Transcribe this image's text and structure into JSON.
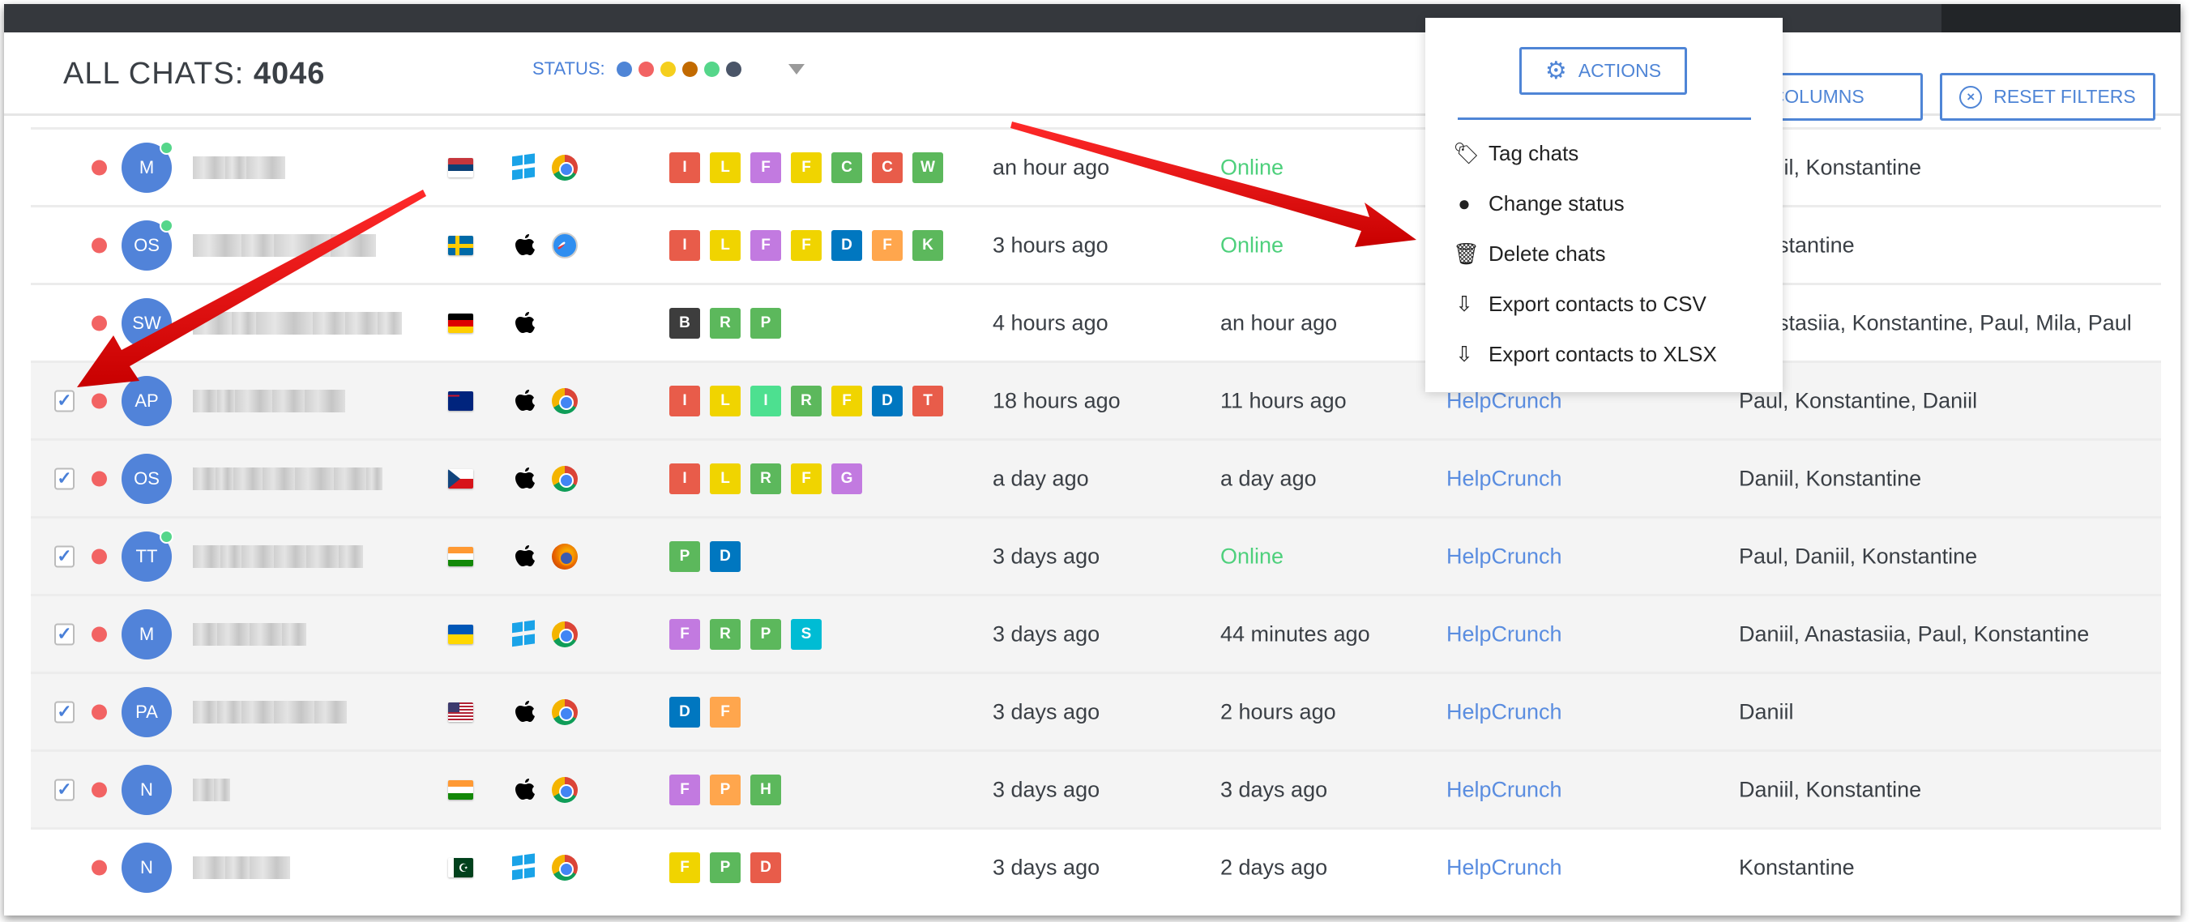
{
  "header": {
    "title_label": "ALL CHATS:",
    "title_count": "4046",
    "status_label": "STATUS:",
    "status_colors": [
      "#4f85d6",
      "#f26363",
      "#f5cf1d",
      "#c26a00",
      "#55d68a",
      "#4a5568"
    ],
    "edit_columns_label": "EDIT COLUMNS",
    "reset_filters_label": "RESET FILTERS"
  },
  "actions_menu": {
    "button_label": "ACTIONS",
    "items": [
      {
        "label": "Tag chats",
        "icon": "tag-icon"
      },
      {
        "label": "Change status",
        "icon": "circle-icon"
      },
      {
        "label": "Delete chats",
        "icon": "trash-icon"
      },
      {
        "label": "Export contacts to CSV",
        "icon": "download-icon"
      },
      {
        "label": "Export contacts to XLSX",
        "icon": "download-icon"
      }
    ]
  },
  "colors": {
    "accent": "#4f85d6",
    "online": "#4ed07c",
    "annotation_arrow": "#e00000"
  },
  "rows": [
    {
      "selected": false,
      "initials": "M",
      "online": true,
      "flag": "serbia",
      "os": "windows",
      "browser": "chrome",
      "tags": [
        [
          "I",
          "#e85c4a"
        ],
        [
          "L",
          "#f0d400"
        ],
        [
          "F",
          "#c27ae0"
        ],
        [
          "F",
          "#f0d400"
        ],
        [
          "C",
          "#5cb85c"
        ],
        [
          "C",
          "#e85c4a"
        ],
        [
          "W",
          "#5cb85c"
        ]
      ],
      "last_message": "an hour ago",
      "last_seen": "Online",
      "department": "",
      "agents": "Daniil, Konstantine"
    },
    {
      "selected": false,
      "initials": "OS",
      "online": true,
      "flag": "sweden",
      "os": "apple",
      "browser": "safari",
      "tags": [
        [
          "I",
          "#e85c4a"
        ],
        [
          "L",
          "#f0d400"
        ],
        [
          "F",
          "#c27ae0"
        ],
        [
          "F",
          "#f0d400"
        ],
        [
          "D",
          "#0077c0"
        ],
        [
          "F",
          "#ffa64d"
        ],
        [
          "K",
          "#5cb85c"
        ]
      ],
      "last_message": "3 hours ago",
      "last_seen": "Online",
      "department": "",
      "agents": "Konstantine"
    },
    {
      "selected": false,
      "initials": "SW",
      "online": false,
      "flag": "germany",
      "os": "apple",
      "browser": "",
      "tags": [
        [
          "B",
          "#3d3d3d"
        ],
        [
          "R",
          "#5cb85c"
        ],
        [
          "P",
          "#5cb85c"
        ]
      ],
      "last_message": "4 hours ago",
      "last_seen": "an hour ago",
      "department": "",
      "agents": "Anastasiia, Konstantine, Paul, Mila, Paul"
    },
    {
      "selected": true,
      "initials": "AP",
      "online": false,
      "flag": "new-zealand",
      "os": "apple",
      "browser": "chrome",
      "tags": [
        [
          "I",
          "#e85c4a"
        ],
        [
          "L",
          "#f0d400"
        ],
        [
          "I",
          "#4de090"
        ],
        [
          "R",
          "#5cb85c"
        ],
        [
          "F",
          "#f0d400"
        ],
        [
          "D",
          "#0077c0"
        ],
        [
          "T",
          "#e85c4a"
        ]
      ],
      "last_message": "18 hours ago",
      "last_seen": "11 hours ago",
      "department": "HelpCrunch",
      "agents": "Paul, Konstantine, Daniil"
    },
    {
      "selected": true,
      "initials": "OS",
      "online": false,
      "flag": "czech",
      "os": "apple",
      "browser": "chrome",
      "tags": [
        [
          "I",
          "#e85c4a"
        ],
        [
          "L",
          "#f0d400"
        ],
        [
          "R",
          "#5cb85c"
        ],
        [
          "F",
          "#f0d400"
        ],
        [
          "G",
          "#c27ae0"
        ]
      ],
      "last_message": "a day ago",
      "last_seen": "a day ago",
      "department": "HelpCrunch",
      "agents": "Daniil, Konstantine"
    },
    {
      "selected": true,
      "initials": "TT",
      "online": true,
      "flag": "india",
      "os": "apple",
      "browser": "firefox",
      "tags": [
        [
          "P",
          "#5cb85c"
        ],
        [
          "D",
          "#0077c0"
        ]
      ],
      "last_message": "3 days ago",
      "last_seen": "Online",
      "department": "HelpCrunch",
      "agents": "Paul, Daniil, Konstantine"
    },
    {
      "selected": true,
      "initials": "M",
      "online": false,
      "flag": "ukraine",
      "os": "windows",
      "browser": "chrome",
      "tags": [
        [
          "F",
          "#c27ae0"
        ],
        [
          "R",
          "#5cb85c"
        ],
        [
          "P",
          "#5cb85c"
        ],
        [
          "S",
          "#00bcd4"
        ]
      ],
      "last_message": "3 days ago",
      "last_seen": "44 minutes ago",
      "department": "HelpCrunch",
      "agents": "Daniil, Anastasiia, Paul, Konstantine"
    },
    {
      "selected": true,
      "initials": "PA",
      "online": false,
      "flag": "usa",
      "os": "apple",
      "browser": "chrome",
      "tags": [
        [
          "D",
          "#0077c0"
        ],
        [
          "F",
          "#ffa64d"
        ]
      ],
      "last_message": "3 days ago",
      "last_seen": "2 hours ago",
      "department": "HelpCrunch",
      "agents": "Daniil"
    },
    {
      "selected": true,
      "initials": "N",
      "online": false,
      "flag": "india",
      "os": "apple",
      "browser": "chrome",
      "tags": [
        [
          "F",
          "#c27ae0"
        ],
        [
          "P",
          "#ffa64d"
        ],
        [
          "H",
          "#5cb85c"
        ]
      ],
      "last_message": "3 days ago",
      "last_seen": "3 days ago",
      "department": "HelpCrunch",
      "agents": "Daniil, Konstantine"
    },
    {
      "selected": false,
      "initials": "N",
      "online": false,
      "flag": "pakistan",
      "os": "windows",
      "browser": "chrome",
      "tags": [
        [
          "F",
          "#f0d400"
        ],
        [
          "P",
          "#5cb85c"
        ],
        [
          "D",
          "#e85c4a"
        ]
      ],
      "last_message": "3 days ago",
      "last_seen": "2 days ago",
      "department": "HelpCrunch",
      "agents": "Konstantine"
    }
  ]
}
